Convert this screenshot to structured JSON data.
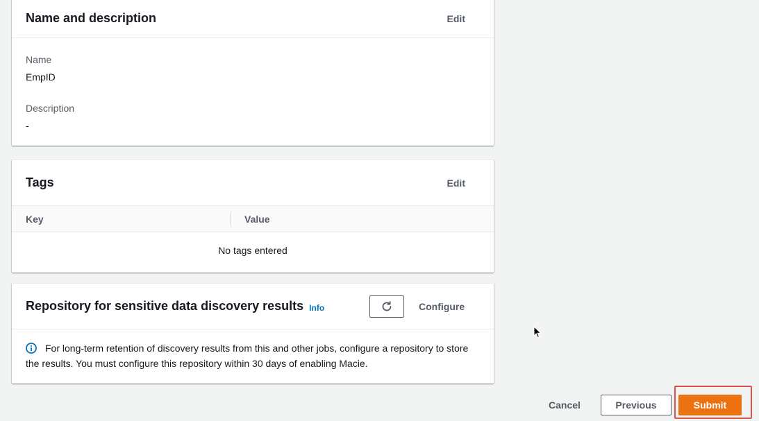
{
  "name_panel": {
    "title": "Name and description",
    "edit_label": "Edit",
    "name_label": "Name",
    "name_value": "EmpID",
    "description_label": "Description",
    "description_value": "-"
  },
  "tags_panel": {
    "title": "Tags",
    "edit_label": "Edit",
    "columns": [
      "Key",
      "Value"
    ],
    "empty_message": "No tags entered"
  },
  "repository_panel": {
    "title": "Repository for sensitive data discovery results",
    "info_label": "Info",
    "refresh_icon": "refresh-icon",
    "configure_label": "Configure",
    "alert_icon": "info-circle-icon",
    "alert_text": "For long-term retention of discovery results from this and other jobs, configure a repository to store the results. You must configure this repository within 30 days of enabling Macie."
  },
  "footer": {
    "cancel_label": "Cancel",
    "previous_label": "Previous",
    "submit_label": "Submit"
  },
  "colors": {
    "primary": "#ec7211",
    "link": "#0073bb",
    "highlight": "#d9534f",
    "background": "#f2f3f3"
  }
}
